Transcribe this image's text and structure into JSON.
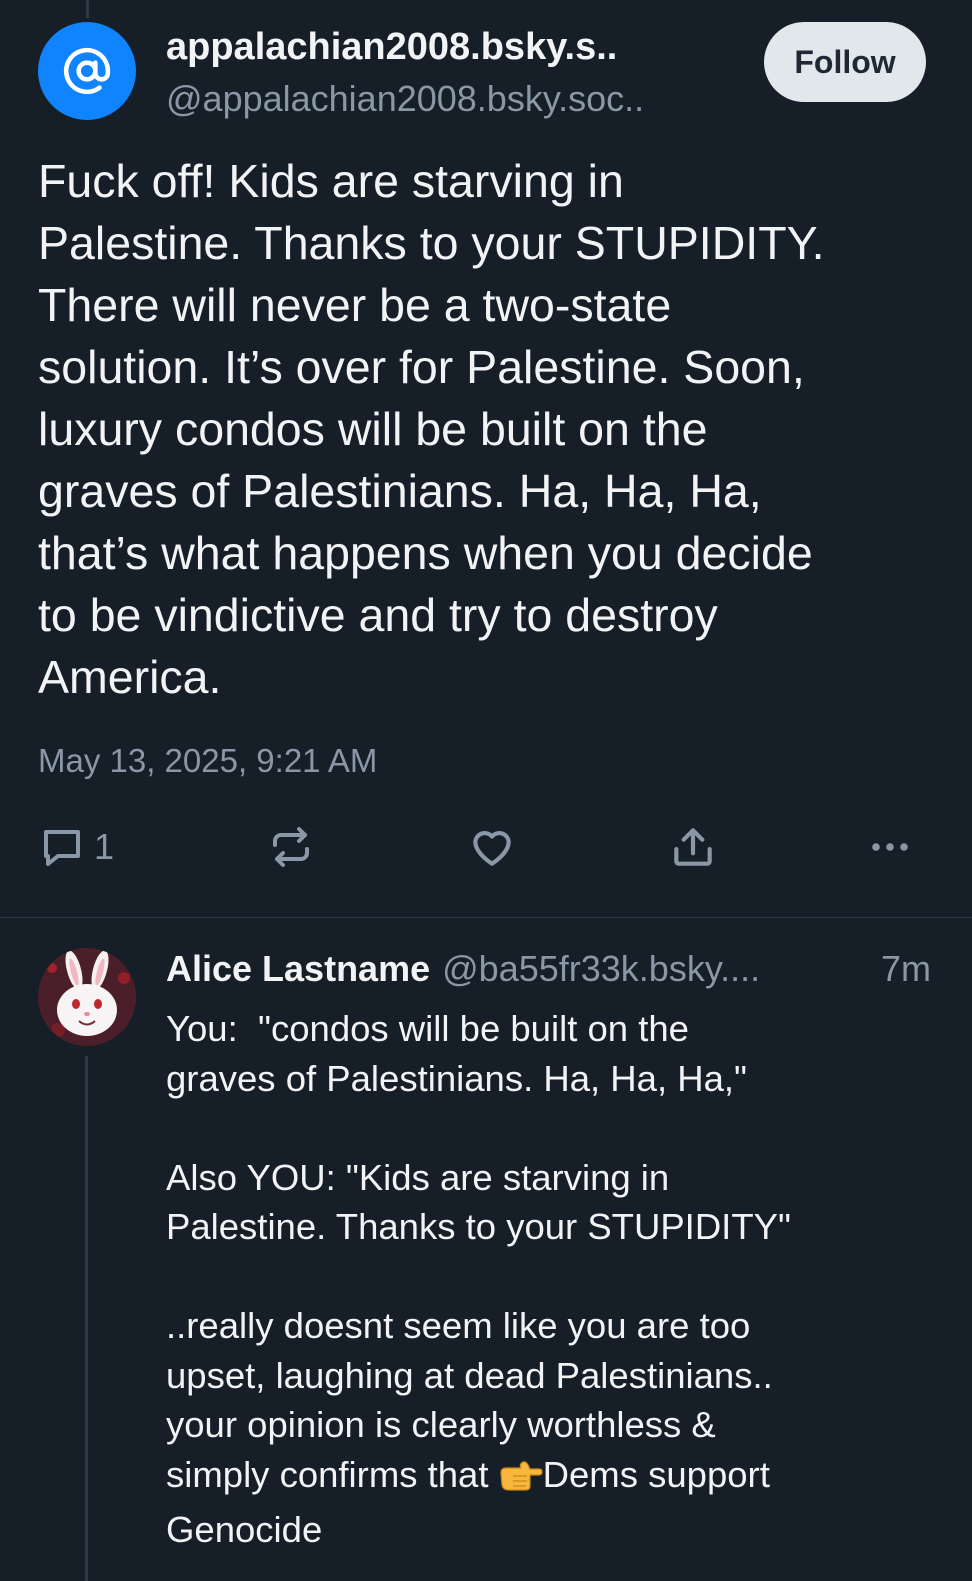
{
  "post": {
    "author_display_name": "appalachian2008.bsky.s..",
    "author_handle": "@appalachian2008.bsky.soc..",
    "avatar_icon": "at-sign-icon",
    "follow_label": "Follow",
    "text": "Fuck off! Kids are starving in\nPalestine. Thanks to your STUPIDITY.\nThere will never be a two-state\nsolution. It’s over for Palestine. Soon,\nluxury condos will be built on the\ngraves of Palestinians. Ha, Ha, Ha,\nthat’s what happens when you decide\nto be vindictive and try to destroy\nAmerica.",
    "timestamp": "May 13, 2025, 9:21 AM",
    "actions": {
      "reply_icon": "reply-bubble-icon",
      "reply_count": "1",
      "repost_icon": "repost-icon",
      "like_icon": "heart-icon",
      "share_icon": "share-icon",
      "more_icon": "more-dots-icon"
    }
  },
  "reply": {
    "author_display_name": "Alice Lastname",
    "author_handle": "@ba55fr33k.bsky....",
    "time_ago": "7m",
    "avatar_icon": "bunny-avatar",
    "text_before_emoji": "You:  \"condos will be built on the\ngraves of Palestinians. Ha, Ha, Ha,\"\n\nAlso YOU: \"Kids are starving in\nPalestine. Thanks to your STUPIDITY\"\n\n..really doesnt seem like you are too\nupset, laughing at dead Palestinians..\nyour opinion is clearly worthless &\nsimply confirms that ",
    "emoji_icon": "pointing-finger-icon",
    "text_after_emoji": "Dems support\nGenocide"
  },
  "colors": {
    "background": "#161e27",
    "avatar_blue": "#1083fe",
    "text_primary": "#f1f3f5",
    "text_secondary": "#8a97a6",
    "follow_button_bg": "#e2e7ec"
  }
}
